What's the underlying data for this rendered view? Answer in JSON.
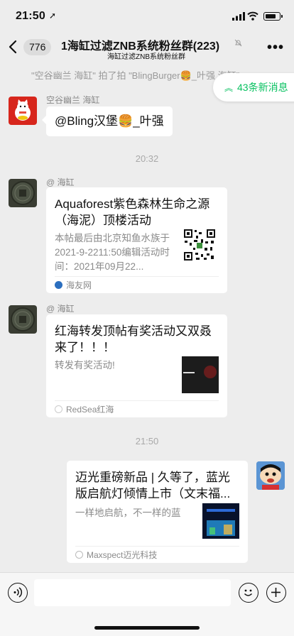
{
  "status": {
    "time": "21:50",
    "location_icon": "location-arrow-icon"
  },
  "header": {
    "back_icon": "chevron-left-icon",
    "unread_count": "776",
    "title": "1海缸过滤ZNB系统粉丝群(223)",
    "subtitle": "海缸过滤ZNB系统粉丝群",
    "more_label": "•••"
  },
  "notice": "\"空谷幽兰 海缸\" 拍了拍 \"BlingBurger🍔_叶强 海缸\"",
  "new_messages": "43条新消息",
  "messages": [
    {
      "sender": "空谷幽兰 海缸",
      "text": "@Bling汉堡🍔_叶强"
    },
    {
      "time": "20:32"
    },
    {
      "sender": "@ 海缸",
      "title": "Aquaforest紫色森林生命之源（海泥）顶楼活动",
      "desc": "本帖最后由北京知鱼水族于2021-9-2211:50编辑活动时间：2021年09月22...",
      "source": "海友网"
    },
    {
      "sender": "@ 海缸",
      "title": "红海转发顶帖有奖活动又双叒来了！！！",
      "desc": "转发有奖活动!",
      "source": "RedSea红海"
    },
    {
      "time": "21:50"
    },
    {
      "title": "迈光重磅新品 | 久等了，蓝光版启航灯倾情上市（文末福...",
      "desc": "一样地启航，不一样的蓝",
      "source": "Maxspect迈光科技"
    }
  ]
}
